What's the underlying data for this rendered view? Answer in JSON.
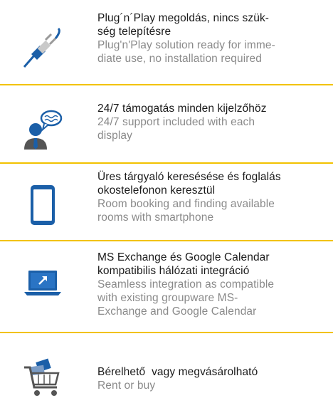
{
  "features": [
    {
      "hu": [
        "Plug´n´Play megoldás, nincs szük-",
        "ség telepítésre"
      ],
      "en": [
        "Plug'n'Play solution ready for imme-",
        "diate use, no installation required"
      ],
      "icon": "plug-icon"
    },
    {
      "hu": [
        "24/7 támogatás minden kijelzőhöz"
      ],
      "en": [
        "24/7 support included with each",
        "display"
      ],
      "icon": "support-agent-icon"
    },
    {
      "hu": [
        "Üres tárgyaló keresésése és foglalás",
        "okostelefonon keresztül"
      ],
      "en": [
        "Room booking and finding available",
        "rooms with smartphone"
      ],
      "icon": "smartphone-icon"
    },
    {
      "hu": [
        "MS Exchange és Google Calendar",
        "kompatibilis hálózati integráció"
      ],
      "en": [
        "Seamless integration as compatible",
        "with existing groupware MS-",
        "Exchange and Google Calendar"
      ],
      "icon": "laptop-icon"
    },
    {
      "hu": [
        "Bérelhető  vagy megvásárolható"
      ],
      "en": [
        "Rent or buy"
      ],
      "icon": "shopping-cart-icon"
    }
  ],
  "colors": {
    "accent": "#f2c200",
    "icon_blue": "#1b5fa8",
    "text_dark": "#1a1a1a",
    "text_grey": "#8a8a8a"
  }
}
